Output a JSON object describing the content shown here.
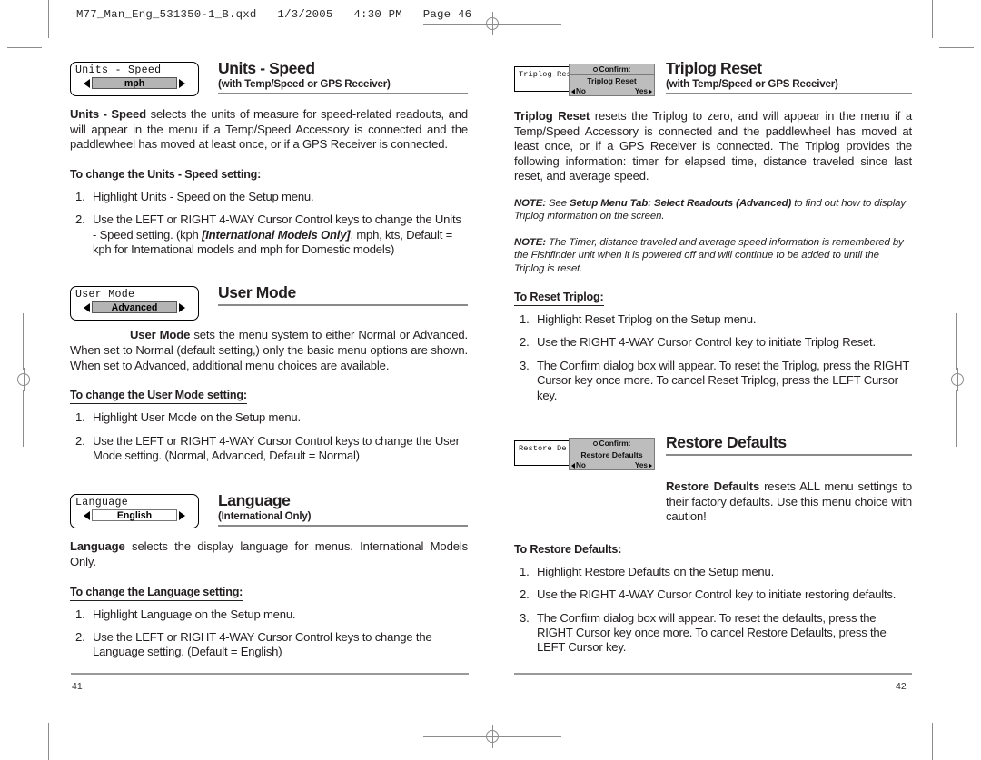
{
  "header": {
    "file_line": "M77_Man_Eng_531350-1_B.qxd   1/3/2005   4:30 PM   Page 46"
  },
  "left_column": {
    "sections": [
      {
        "widget": {
          "type": "menu-slider",
          "label": "Units - Speed",
          "value": "mph",
          "left_arrow": "◀",
          "right_arrow": "▶"
        },
        "title": "Units - Speed",
        "subtitle": "(with Temp/Speed or GPS Receiver)",
        "body": "selects the units of measure for speed-related readouts, and will appear in the menu if a Temp/Speed Accessory is connected and the paddlewheel has moved at least once, or if a GPS Receiver is connected.",
        "body_lead": "Units - Speed",
        "steps_heading": "To change the Units - Speed setting:",
        "steps": [
          {
            "num": "1.",
            "pre": "Highlight Units - Speed on the Setup menu.",
            "em": "",
            "post": ""
          },
          {
            "num": "2.",
            "pre": "Use the LEFT or RIGHT 4-WAY Cursor Control keys to change the Units - Speed setting. (kph ",
            "em": "[International Models Only]",
            "post": ", mph, kts, Default = kph for International models and mph for Domestic models)"
          }
        ]
      },
      {
        "widget": {
          "type": "menu-slider",
          "label": "User Mode",
          "value": "Advanced",
          "left_arrow": "◀",
          "right_arrow": "▶"
        },
        "title": "User Mode",
        "subtitle": "",
        "body": "sets the menu system to either Normal or Advanced. When set to Normal (default setting,) only the basic menu options are shown. When set to Advanced, additional menu choices are available.",
        "body_lead": "User Mode",
        "steps_heading": "To change the User Mode setting:",
        "steps": [
          {
            "num": "1.",
            "pre": "Highlight User Mode on the Setup menu.",
            "em": "",
            "post": ""
          },
          {
            "num": "2.",
            "pre": "Use the LEFT or RIGHT 4-WAY Cursor Control keys to change the User Mode setting. (Normal, Advanced, Default = Normal)",
            "em": "",
            "post": ""
          }
        ]
      },
      {
        "widget": {
          "type": "menu-slider",
          "label": "Language",
          "value": "English",
          "left_arrow": "◀",
          "right_arrow": "▶"
        },
        "title": "Language",
        "subtitle": "(International Only)",
        "body": "selects the display language for menus. International Models Only.",
        "body_lead": "Language",
        "steps_heading": "To change the Language setting:",
        "steps": [
          {
            "num": "1.",
            "pre": "Highlight Language on the Setup menu.",
            "em": "",
            "post": ""
          },
          {
            "num": "2.",
            "pre": "Use the LEFT or RIGHT 4-WAY Cursor Control keys to change the Language setting. (Default = English)",
            "em": "",
            "post": ""
          }
        ]
      }
    ]
  },
  "right_column": {
    "sections": [
      {
        "widget": {
          "type": "confirm-dialog",
          "background_label": "Triplog Rese",
          "dialog_title": "Confirm:",
          "dialog_body": "Triplog Reset",
          "no_label": "No",
          "yes_label": "Yes"
        },
        "title": "Triplog Reset",
        "subtitle": "(with Temp/Speed or GPS Receiver)",
        "body_lead": "Triplog Reset",
        "body": "resets the Triplog to zero, and will appear in the menu if a Temp/Speed Accessory is connected and the paddlewheel has moved at least once, or if a GPS Receiver is connected. The Triplog provides the following information: timer for elapsed time, distance traveled since last reset, and average speed.",
        "notes": [
          {
            "label": "NOTE:",
            "pre": " See ",
            "em": "Setup Menu Tab: Select Readouts (Advanced)",
            "post": " to find out how to display Triplog information on the screen."
          },
          {
            "label": "NOTE:",
            "pre": " The Timer, distance traveled and average speed information is remembered by the Fishfinder unit when it is powered off and will continue to be added to until the Triplog is reset.",
            "em": "",
            "post": ""
          }
        ],
        "steps_heading": "To Reset Triplog:",
        "steps": [
          {
            "num": "1.",
            "pre": "Highlight Reset Triplog on the Setup menu.",
            "em": "",
            "post": ""
          },
          {
            "num": "2.",
            "pre": "Use the RIGHT 4-WAY Cursor Control key to initiate Triplog Reset.",
            "em": "",
            "post": ""
          },
          {
            "num": "3.",
            "pre": "The Confirm dialog box will appear. To reset the Triplog, press the RIGHT Cursor key once more. To cancel Reset Triplog, press the LEFT Cursor key.",
            "em": "",
            "post": ""
          }
        ]
      },
      {
        "widget": {
          "type": "confirm-dialog",
          "background_label": "Restore De",
          "dialog_title": "Confirm:",
          "dialog_body": "Restore Defaults",
          "no_label": "No",
          "yes_label": "Yes"
        },
        "title": "Restore Defaults",
        "subtitle": "",
        "body_lead": "Restore Defaults",
        "body": "resets ALL menu settings to their factory defaults. Use this menu choice with caution!",
        "notes": [],
        "steps_heading": "To Restore Defaults:",
        "steps": [
          {
            "num": "1.",
            "pre": "Highlight Restore Defaults on the Setup menu.",
            "em": "",
            "post": ""
          },
          {
            "num": "2.",
            "pre": "Use the RIGHT 4-WAY Cursor Control key to initiate restoring defaults.",
            "em": "",
            "post": ""
          },
          {
            "num": "3.",
            "pre": "The Confirm dialog box will appear. To reset the defaults, press the RIGHT Cursor key once more. To cancel Restore Defaults, press the LEFT Cursor key.",
            "em": "",
            "post": ""
          }
        ]
      }
    ]
  },
  "footer": {
    "left_page": "41",
    "right_page": "42"
  },
  "colors": {
    "text": "#231f20",
    "rule": "#8a8a8a",
    "widget_value_fill": "#b4b4b4",
    "dialog_fill": "#bdbdbd",
    "mark": "#8c8c8c"
  }
}
